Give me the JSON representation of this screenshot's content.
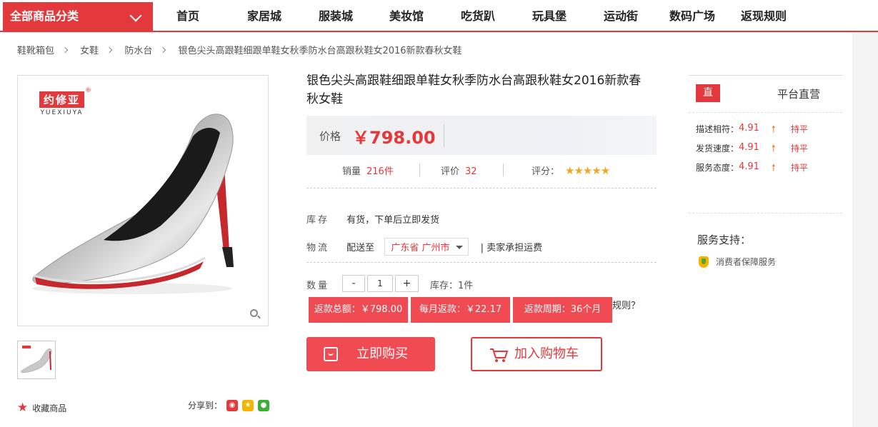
{
  "nav": {
    "category": "全部商品分类",
    "items": [
      "首页",
      "家居城",
      "服装城",
      "美妆馆",
      "吃货趴",
      "玩具堡",
      "运动街",
      "数码广场",
      "返现规则"
    ]
  },
  "breadcrumb": [
    "鞋靴箱包",
    "女鞋",
    "防水台",
    "银色尖头高跟鞋细跟单鞋女秋季防水台高跟秋鞋女2016新款春秋女鞋"
  ],
  "gallery": {
    "brand": "约修亚",
    "brand_sub": "YUEXIUYA",
    "reg": "®"
  },
  "actions": {
    "favorite": "收藏商品",
    "share_label": "分享到："
  },
  "product": {
    "title": "银色尖头高跟鞋细跟单鞋女秋季防水台高跟秋鞋女2016新款春秋女鞋",
    "price_label": "价格",
    "price": "￥798.00",
    "sales_label": "销量",
    "sales": "216件",
    "reviews_label": "评价",
    "reviews": "32",
    "rating_label": "评分：",
    "rating_stars": 5,
    "stock_label": "库存",
    "stock_text": "有货，下单后立即发货",
    "logistics_label": "物流",
    "ship_to": "配送至",
    "location": "广东省 广州市",
    "shipping_note": "| 卖家承担运费",
    "qty_label": "数量",
    "qty_minus": "-",
    "qty_value": "1",
    "qty_plus": "+",
    "inventory": "库存：1件",
    "rebate_total": "返款总额：￥798.00",
    "rebate_monthly": "每月返款：￥22.17",
    "rebate_period": "返款周期：36个月",
    "rules_link": "规则？",
    "buy_now": "立即购买",
    "add_cart": "加入购物车"
  },
  "sidebar": {
    "badge": "直",
    "shop_type": "平台直营",
    "scores": [
      {
        "label": "描述相符：",
        "value": "4.91",
        "trend": "持平"
      },
      {
        "label": "发货速度：",
        "value": "4.91",
        "trend": "持平"
      },
      {
        "label": "服务态度：",
        "value": "4.91",
        "trend": "持平"
      }
    ],
    "service_title": "服务支持：",
    "service_item": "消费者保障服务"
  },
  "colors": {
    "accent": "#e4393c",
    "button": "#f04a53",
    "star": "#f5a623"
  }
}
